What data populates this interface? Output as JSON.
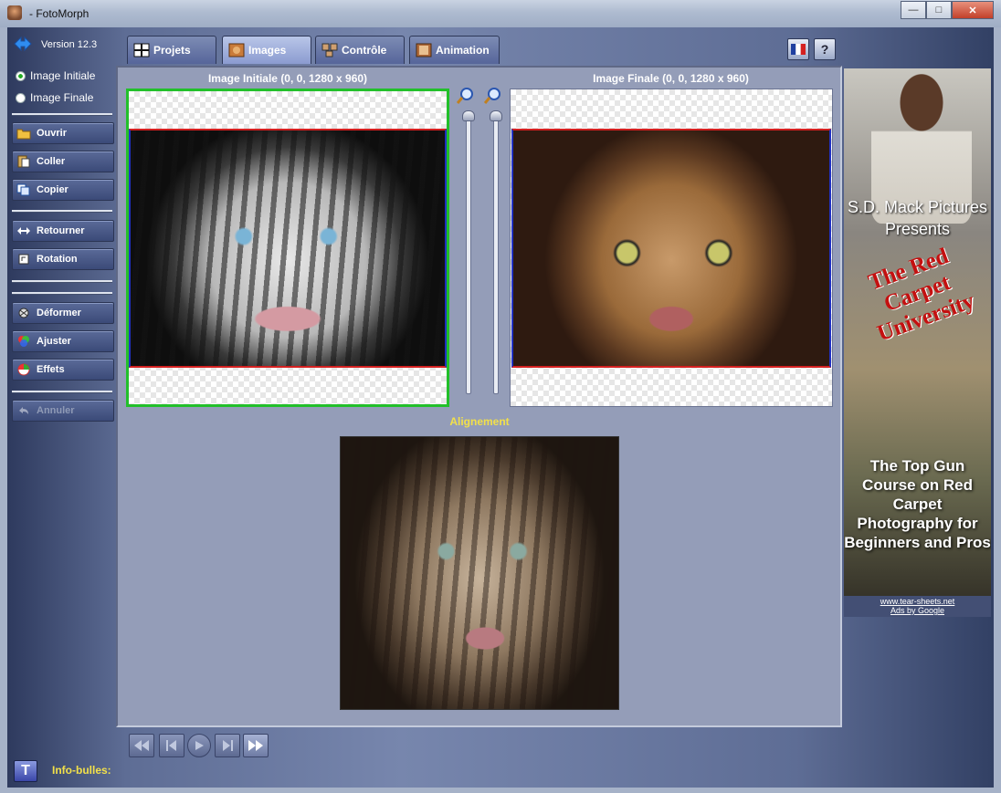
{
  "window": {
    "title": "- FotoMorph"
  },
  "sidebar": {
    "version": "Version 12.3",
    "radios": [
      {
        "label": "Image Initiale",
        "selected": true
      },
      {
        "label": "Image Finale",
        "selected": false
      }
    ],
    "buttons": {
      "ouvrir": "Ouvrir",
      "coller": "Coller",
      "copier": "Copier",
      "retourner": "Retourner",
      "rotation": "Rotation",
      "deformer": "Déformer",
      "ajuster": "Ajuster",
      "effets": "Effets",
      "annuler": "Annuler"
    }
  },
  "tabs": [
    {
      "label": "Projets",
      "active": false
    },
    {
      "label": "Images",
      "active": true
    },
    {
      "label": "Contrôle",
      "active": false
    },
    {
      "label": "Animation",
      "active": false
    }
  ],
  "main": {
    "initial_caption": "Image Initiale (0, 0, 1280 x 960)",
    "final_caption": "Image Finale (0, 0, 1280 x 960)",
    "alignment_caption": "Alignement"
  },
  "ad": {
    "line1": "S.D. Mack Pictures Presents",
    "title": "The Red Carpet University",
    "tagline": "The Top Gun Course on Red Carpet Photography for Beginners and Pros",
    "url": "www.tear-sheets.net",
    "ads_by": "Ads by Google"
  },
  "footer": {
    "infobulles": "Info-bulles:"
  },
  "colors": {
    "accent_yellow": "#f2e04a",
    "selection_green": "#22c02a",
    "crop_red": "#d42020"
  }
}
